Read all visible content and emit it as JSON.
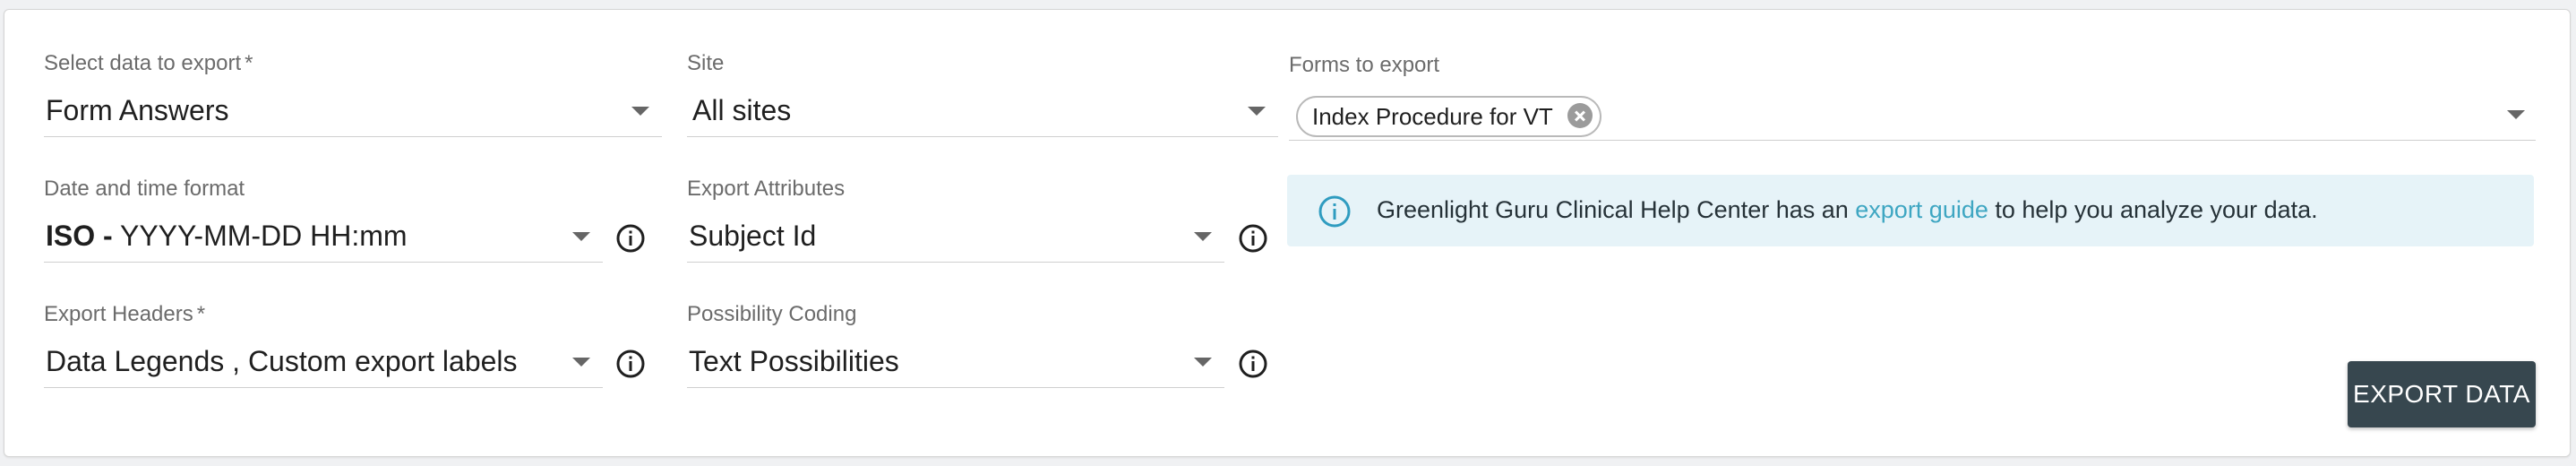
{
  "form": {
    "data_select": {
      "label": "Select data to export",
      "required_mark": "*",
      "value": "Form Answers"
    },
    "site": {
      "label": "Site",
      "value": "All sites"
    },
    "forms": {
      "label": "Forms to export",
      "chips": [
        "Index Procedure for VT"
      ]
    },
    "date_format": {
      "label": "Date and time format",
      "value_bold": "ISO -",
      "value_rest": " YYYY-MM-DD HH:mm"
    },
    "export_attributes": {
      "label": "Export Attributes",
      "value": "Subject Id"
    },
    "export_headers": {
      "label": "Export Headers",
      "required_mark": "*",
      "value": "Data Legends , Custom export labels"
    },
    "possibility_coding": {
      "label": "Possibility Coding",
      "value": "Text Possibilities"
    }
  },
  "info_banner": {
    "text_before": "Greenlight Guru Clinical Help Center has an ",
    "link_text": "export guide",
    "text_after": " to help you analyze your data."
  },
  "actions": {
    "export_label": "EXPORT DATA"
  },
  "icons": {
    "info": "info-circle-icon",
    "caret": "caret-down-icon",
    "chip_remove": "close-circle-icon"
  },
  "colors": {
    "accent": "#3ea6c2",
    "info_bg": "#e6f3f8",
    "button_bg": "#37474f"
  }
}
